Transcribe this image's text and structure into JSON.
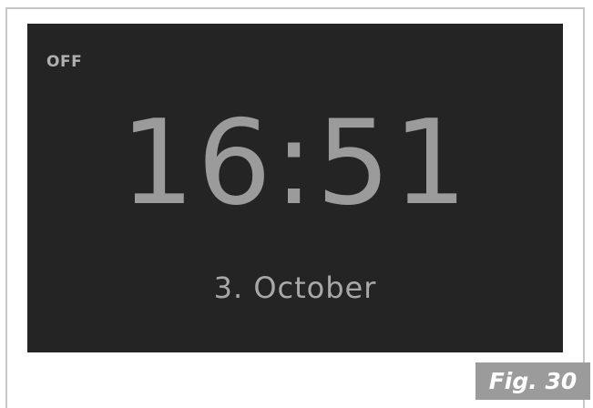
{
  "display": {
    "status": "OFF",
    "time": "16:51",
    "date": "3. October"
  },
  "figure": {
    "label": "Fig. 30"
  },
  "colors": {
    "screen_background": "#242424",
    "display_text": "#9b9b9b",
    "figure_label_background": "#9b9b9b",
    "figure_label_text": "#ffffff"
  }
}
